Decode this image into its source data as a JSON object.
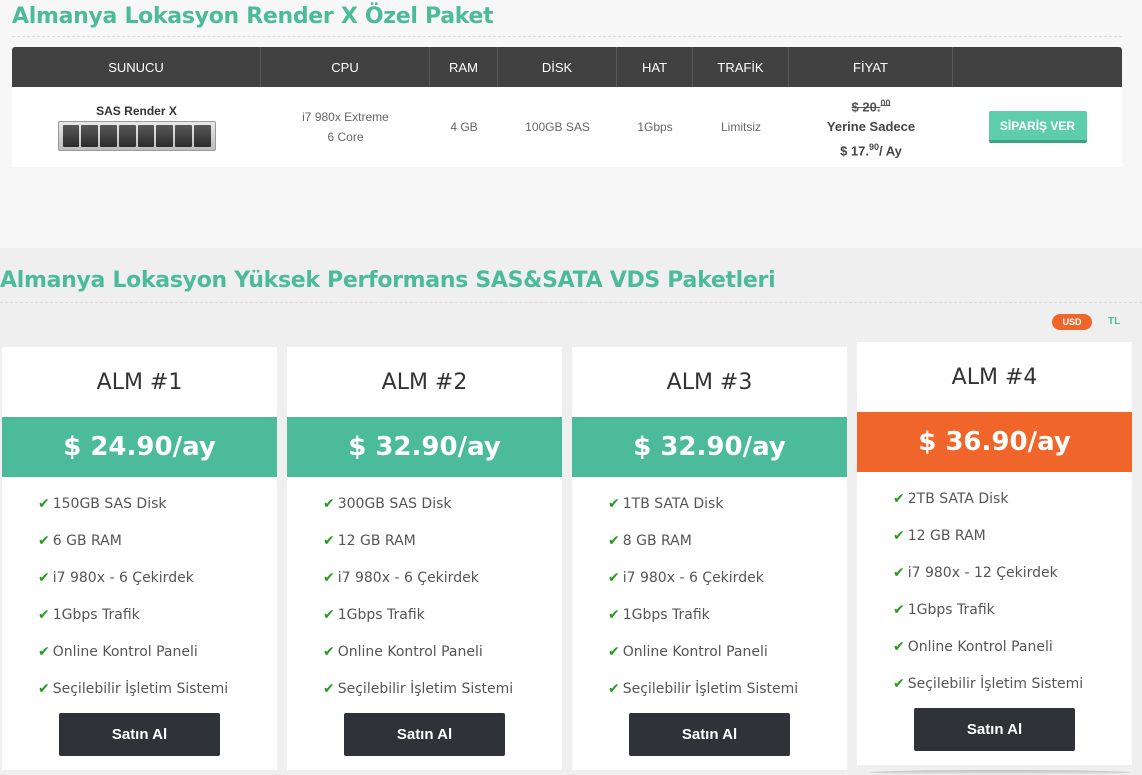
{
  "special": {
    "title": "Almanya Lokasyon Render X Özel Paket",
    "columns": [
      "SUNUCU",
      "CPU",
      "RAM",
      "DİSK",
      "HAT",
      "TRAFİK",
      "FİYAT",
      ""
    ],
    "row": {
      "server_name": "SAS Render X",
      "cpu_line1": "i7 980x Extreme",
      "cpu_line2": "6 Core",
      "ram": "4 GB",
      "disk": "100GB SAS",
      "line": "1Gbps",
      "traffic": "Limitsiz",
      "old_price_main": "$ 20.",
      "old_price_cents": "00",
      "instead_label": "Yerine Sadece",
      "new_price_main": "$ 17.",
      "new_price_cents": "90",
      "new_price_suffix": "/ Ay",
      "order_label": "SİPARİŞ VER"
    }
  },
  "vds": {
    "title": "Almanya Lokasyon Yüksek Performans SAS&SATA VDS Paketleri",
    "currency_active": "USD",
    "currency_other": "TL",
    "buy_label": "Satın Al",
    "check_icon": "✔",
    "plans": [
      {
        "name": "ALM #1",
        "price": "$ 24.90/ay",
        "color": "#4cbb99",
        "features": [
          "150GB SAS Disk",
          "6 GB RAM",
          "i7 980x - 6 Çekirdek",
          "1Gbps Trafik",
          "Online Kontrol Paneli",
          "Seçilebilir İşletim Sistemi"
        ]
      },
      {
        "name": "ALM #2",
        "price": "$ 32.90/ay",
        "color": "#4cbb99",
        "features": [
          "300GB SAS Disk",
          "12 GB RAM",
          "i7 980x - 6 Çekirdek",
          "1Gbps Trafik",
          "Online Kontrol Paneli",
          "Seçilebilir İşletim Sistemi"
        ]
      },
      {
        "name": "ALM #3",
        "price": "$ 32.90/ay",
        "color": "#4cbb99",
        "features": [
          "1TB SATA Disk",
          "8 GB RAM",
          "i7 980x - 6 Çekirdek",
          "1Gbps Trafik",
          "Online Kontrol Paneli",
          "Seçilebilir İşletim Sistemi"
        ]
      },
      {
        "name": "ALM #4",
        "price": "$ 36.90/ay",
        "color": "#f0662a",
        "features": [
          "2TB SATA Disk",
          "12 GB RAM",
          "i7 980x - 12 Çekirdek",
          "1Gbps Trafik",
          "Online Kontrol Paneli",
          "Seçilebilir İşletim Sistemi"
        ]
      }
    ]
  }
}
